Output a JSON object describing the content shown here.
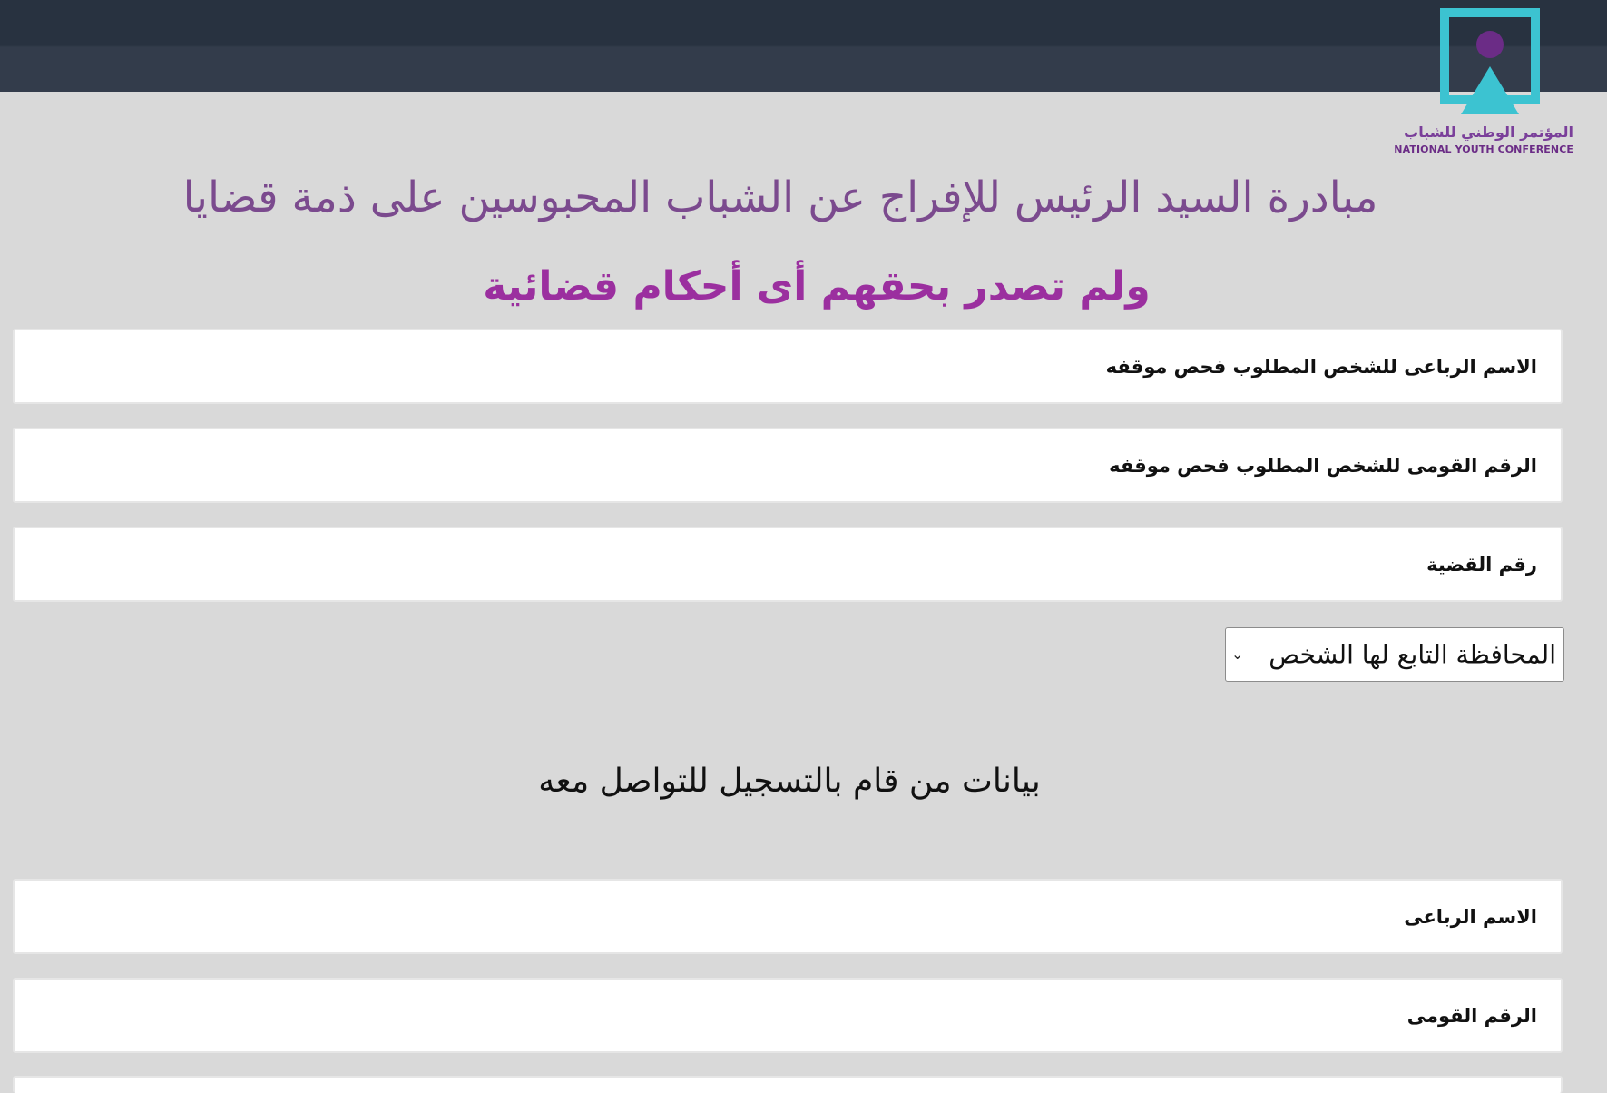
{
  "header": {
    "logo_ar": "المؤتمر الوطني للشباب",
    "logo_en": "NATIONAL YOUTH CONFERENCE",
    "logo_colors": {
      "frame": "#3cc3d1",
      "circle": "#6b2c86"
    }
  },
  "titles": {
    "main": "مبادرة السيد الرئيس للإفراج عن الشباب المحبوسين على ذمة قضايا",
    "sub": "ولم تصدر بحقهم أى أحكام قضائية"
  },
  "form": {
    "fields": [
      {
        "label": "الاسم الرباعى للشخص المطلوب فحص موقفه"
      },
      {
        "label": "الرقم القومى للشخص المطلوب فحص موقفه"
      },
      {
        "label": "رقم القضية"
      }
    ],
    "governorate_select": {
      "selected": "المحافظة التابع لها الشخص",
      "icon": "chevron-down-icon"
    },
    "contact_section_title": "بيانات من قام بالتسجيل للتواصل معه",
    "contact_fields": [
      {
        "label": "الاسم الرباعى"
      },
      {
        "label": "الرقم القومى"
      },
      {
        "label": ""
      }
    ]
  },
  "colors": {
    "topbar": "#2f3846",
    "title": "#7b4a8e",
    "subtitle": "#9b2f9f",
    "background": "#d9d9d9"
  }
}
